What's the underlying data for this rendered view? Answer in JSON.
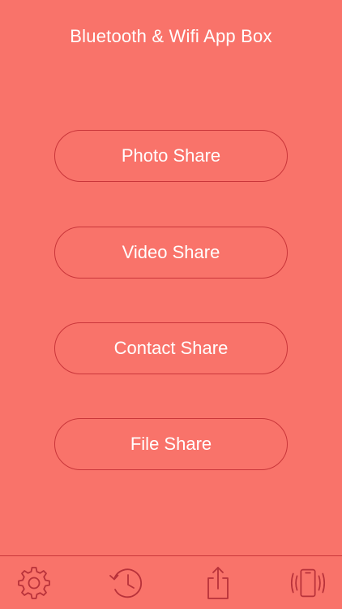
{
  "header": {
    "title": "Bluetooth & Wifi App Box"
  },
  "menu": {
    "photo_share": "Photo Share",
    "video_share": "Video Share",
    "contact_share": "Contact Share",
    "file_share": "File Share"
  },
  "tabbar": {
    "icons": [
      "gear-icon",
      "history-icon",
      "share-icon",
      "vibrating-phone-icon"
    ]
  },
  "colors": {
    "background": "#f9736a",
    "border": "#c9363a",
    "text": "#ffffff"
  }
}
